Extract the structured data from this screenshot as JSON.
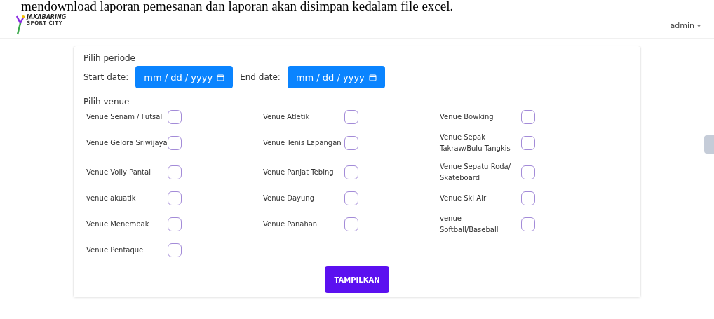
{
  "document_text": "mendownload laporan pemesanan dan laporan akan disimpan kedalam file excel.",
  "header": {
    "logo_text": "JAKABARING",
    "logo_subtext": "SPORT CITY",
    "user_menu": "admin"
  },
  "form": {
    "period_title": "Pilih periode",
    "date_fields": [
      {
        "label": "Start date:",
        "placeholder": "mm / dd / yyyy"
      },
      {
        "label": "End date:",
        "placeholder": "mm / dd / yyyy"
      }
    ],
    "venue_title": "Pilih venue",
    "venues": [
      {
        "label": "Venue Senam / Futsal",
        "checked": false
      },
      {
        "label": "Venue Atletik",
        "checked": false
      },
      {
        "label": "Venue Bowking",
        "checked": false
      },
      {
        "label": "Venue Gelora Sriwijaya",
        "checked": false
      },
      {
        "label": "Venue Tenis Lapangan",
        "checked": false
      },
      {
        "label": "Venue Sepak Takraw/Bulu Tangkis",
        "checked": false
      },
      {
        "label": "Venue Volly Pantai",
        "checked": false
      },
      {
        "label": "Venue Panjat Tebing",
        "checked": false
      },
      {
        "label": "Venue Sepatu Roda/ Skateboard",
        "checked": false
      },
      {
        "label": "venue akuatik",
        "checked": false
      },
      {
        "label": "Venue Dayung",
        "checked": false
      },
      {
        "label": "Venue Ski Air",
        "checked": false
      },
      {
        "label": "Venue Menembak",
        "checked": false
      },
      {
        "label": "Venue Panahan",
        "checked": false
      },
      {
        "label": "venue Softball/Baseball",
        "checked": false
      },
      {
        "label": "Venue Pentaque",
        "checked": false
      }
    ],
    "submit_button": "TAMPILKAN"
  }
}
